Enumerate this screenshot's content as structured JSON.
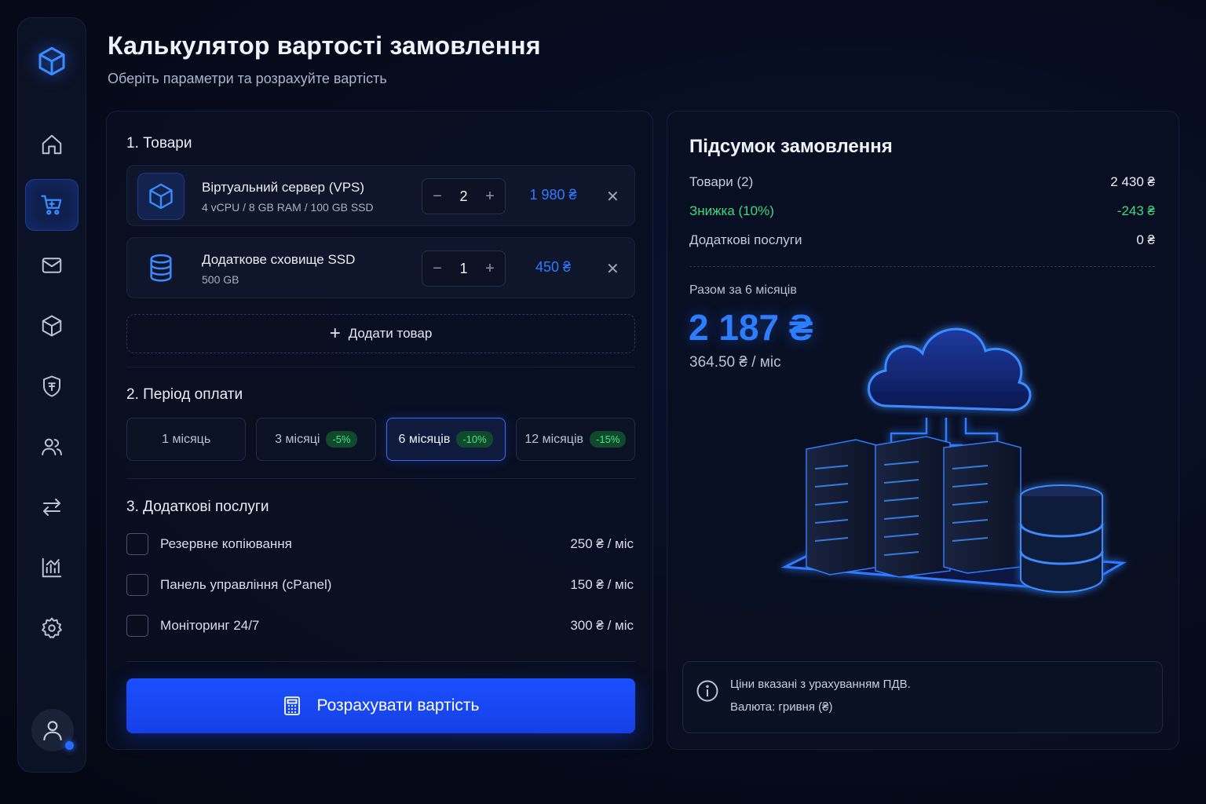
{
  "header": {
    "title": "Калькулятор вартості замовлення",
    "subtitle": "Оберіть параметри та розрахуйте вартість"
  },
  "sidebar": {
    "logo_icon": "cube-logo-icon",
    "items": [
      {
        "icon": "home-icon",
        "active": false
      },
      {
        "icon": "cart-icon",
        "active": true
      },
      {
        "icon": "mail-icon",
        "active": false
      },
      {
        "icon": "box-icon",
        "active": false
      },
      {
        "icon": "shield-currency-icon",
        "active": false
      },
      {
        "icon": "users-icon",
        "active": false
      },
      {
        "icon": "transfer-icon",
        "active": false
      },
      {
        "icon": "analytics-icon",
        "active": false
      },
      {
        "icon": "gear-icon",
        "active": false
      }
    ],
    "avatar_icon": "user-icon"
  },
  "products": {
    "title": "1. Товари",
    "items": [
      {
        "name": "Віртуальний сервер (VPS)",
        "spec": "4 vCPU / 8 GB RAM / 100 GB SSD",
        "qty": "2",
        "price": "1 980 ₴",
        "icon": "cube-icon"
      },
      {
        "name": "Додаткове сховище SSD",
        "spec": "500 GB",
        "qty": "1",
        "price": "450 ₴",
        "icon": "database-icon"
      }
    ],
    "add_label": "Додати товар"
  },
  "period": {
    "title": "2. Період оплати",
    "options": [
      {
        "label": "1 місяць",
        "badge": "",
        "selected": false
      },
      {
        "label": "3 місяці",
        "badge": "-5%",
        "selected": false
      },
      {
        "label": "6 місяців",
        "badge": "-10%",
        "selected": true
      },
      {
        "label": "12 місяців",
        "badge": "-15%",
        "selected": false
      }
    ]
  },
  "addons": {
    "title": "3. Додаткові послуги",
    "items": [
      {
        "label": "Резервне копіювання",
        "price": "250 ₴ / міс",
        "checked": false
      },
      {
        "label": "Панель управління (cPanel)",
        "price": "150 ₴ / міс",
        "checked": false
      },
      {
        "label": "Моніторинг 24/7",
        "price": "300 ₴ / міс",
        "checked": false
      }
    ]
  },
  "calculate_label": "Розрахувати вартість",
  "summary": {
    "title": "Підсумок замовлення",
    "rows": [
      {
        "label": "Товари (2)",
        "value": "2 430 ₴"
      },
      {
        "label": "Знижка (10%)",
        "value": "-243 ₴"
      },
      {
        "label": "Додаткові послуги",
        "value": "0 ₴"
      }
    ],
    "total_label": "Разом за 6 місяців",
    "total_value": "2 187 ₴",
    "per_month": "364.50 ₴ / міс",
    "info_line1": "Ціни вказані з урахуванням ПДВ.",
    "info_line2": "Валюта: гривня (₴)"
  },
  "colors": {
    "accent": "#2f7bff",
    "button": "#1a4fff",
    "discount": "#3ed97f",
    "background": "#060b1c"
  }
}
